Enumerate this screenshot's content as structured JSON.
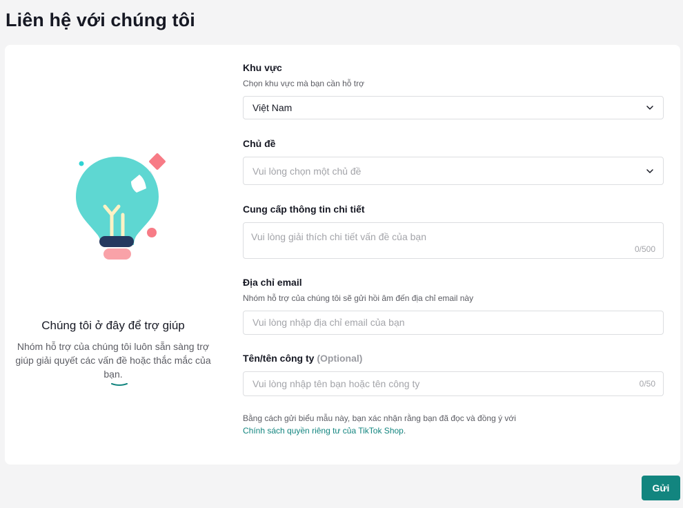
{
  "page": {
    "title": "Liên hệ với chúng tôi"
  },
  "left_panel": {
    "help_title": "Chúng tôi ở đây để trợ giúp",
    "help_description": "Nhóm hỗ trợ của chúng tôi luôn sẵn sàng trợ giúp giải quyết các vấn đề hoặc thắc mắc của bạn.",
    "illustration_icon": "lightbulb-icon"
  },
  "form": {
    "region": {
      "label": "Khu vực",
      "sublabel": "Chọn khu vực mà bạn cần hỗ trợ",
      "value": "Việt Nam"
    },
    "topic": {
      "label": "Chủ đề",
      "placeholder": "Vui lòng chọn một chủ đề"
    },
    "details": {
      "label": "Cung cấp thông tin chi tiết",
      "placeholder": "Vui lòng giải thích chi tiết vấn đề của bạn",
      "counter": "0/500"
    },
    "email": {
      "label": "Địa chỉ email",
      "sublabel": "Nhóm hỗ trợ của chúng tôi sẽ gửi hồi âm đến địa chỉ email này",
      "placeholder": "Vui lòng nhập địa chỉ email của bạn"
    },
    "name": {
      "label": "Tên/tên công ty",
      "optional": "(Optional)",
      "placeholder": "Vui lòng nhập tên bạn hoặc tên công ty",
      "counter": "0/50"
    },
    "consent_text": "Bằng cách gửi biểu mẫu này, bạn xác nhận rằng bạn đã đọc và đồng ý với",
    "privacy_link": "Chính sách quyền riêng tư của TikTok Shop",
    "privacy_link_suffix": "."
  },
  "submit_label": "Gửi",
  "colors": {
    "accent": "#12857f",
    "bulb": "#5ed7d2",
    "pink": "#f77b86",
    "navy": "#25395f",
    "cream": "#fff2c4"
  }
}
